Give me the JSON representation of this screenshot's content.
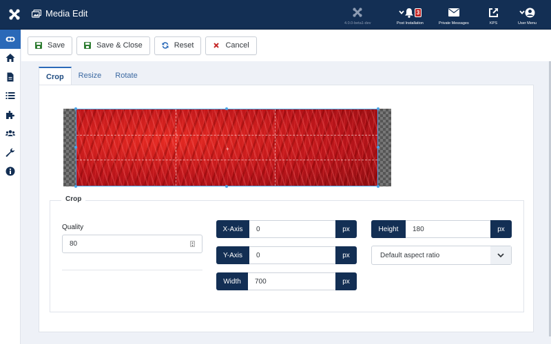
{
  "header": {
    "title": "Media Edit",
    "version_label": "4.0.0-beta1-dev",
    "items": [
      {
        "label": "Post Installation",
        "icon": "bell-icon",
        "badge": "3"
      },
      {
        "label": "Private Messages",
        "icon": "envelope-icon"
      },
      {
        "label": "KPS",
        "icon": "external-link-icon"
      },
      {
        "label": "User Menu",
        "icon": "user-icon"
      }
    ]
  },
  "sidebar": {
    "items": [
      {
        "name": "toggle-menu",
        "icon": "toggle-icon",
        "active": true
      },
      {
        "name": "home",
        "icon": "home-icon"
      },
      {
        "name": "content",
        "icon": "file-icon"
      },
      {
        "name": "menus",
        "icon": "list-icon"
      },
      {
        "name": "components",
        "icon": "puzzle-icon"
      },
      {
        "name": "users",
        "icon": "users-icon"
      },
      {
        "name": "system",
        "icon": "wrench-icon"
      },
      {
        "name": "help",
        "icon": "info-icon"
      }
    ]
  },
  "toolbar": {
    "save": "Save",
    "save_close": "Save & Close",
    "reset": "Reset",
    "cancel": "Cancel",
    "colors": {
      "save": "#2f7d32",
      "reset": "#2a69b8",
      "cancel": "#c52827"
    }
  },
  "tabs": [
    {
      "label": "Crop",
      "active": true
    },
    {
      "label": "Resize",
      "active": false
    },
    {
      "label": "Rotate",
      "active": false
    }
  ],
  "crop": {
    "legend": "Crop",
    "quality_label": "Quality",
    "quality_value": "80",
    "x_axis": {
      "label": "X-Axis",
      "value": "0",
      "unit": "px"
    },
    "y_axis": {
      "label": "Y-Axis",
      "value": "0",
      "unit": "px"
    },
    "width": {
      "label": "Width",
      "value": "700",
      "unit": "px"
    },
    "height": {
      "label": "Height",
      "value": "180",
      "unit": "px"
    },
    "aspect_ratio": "Default aspect ratio"
  },
  "colors": {
    "header_bg": "#132f54",
    "accent": "#2a69b8",
    "addon_bg": "#132f54"
  }
}
